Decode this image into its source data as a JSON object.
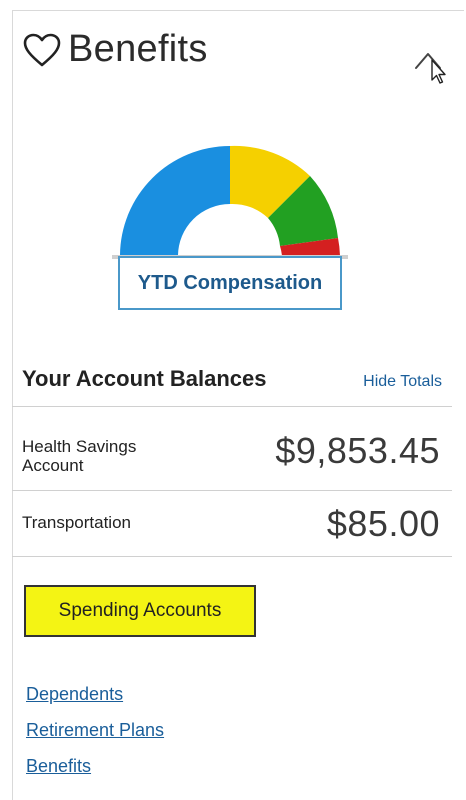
{
  "header": {
    "title": "Benefits",
    "heart_icon": "heart-outline-icon",
    "collapse_icon": "chevron-up-icon"
  },
  "gauge": {
    "segments": [
      {
        "name": "blue",
        "color": "#1a8fe0",
        "share": 0.5
      },
      {
        "name": "yellow",
        "color": "#f5d000",
        "share": 0.2
      },
      {
        "name": "green",
        "color": "#22a022",
        "share": 0.22
      },
      {
        "name": "red",
        "color": "#d42020",
        "share": 0.08
      }
    ]
  },
  "ytd_button": {
    "label": "YTD Compensation"
  },
  "balances": {
    "title": "Your Account Balances",
    "hide_totals": "Hide Totals",
    "rows": [
      {
        "label_line1": "Health Savings",
        "label_line2": "Account",
        "value": "$9,853.45"
      },
      {
        "label_line1": "Transportation",
        "label_line2": "",
        "value": "$85.00"
      }
    ]
  },
  "spending_button": {
    "label": "Spending Accounts",
    "color": "#f4f414"
  },
  "links": [
    "Dependents",
    "Retirement Plans",
    "Benefits"
  ]
}
